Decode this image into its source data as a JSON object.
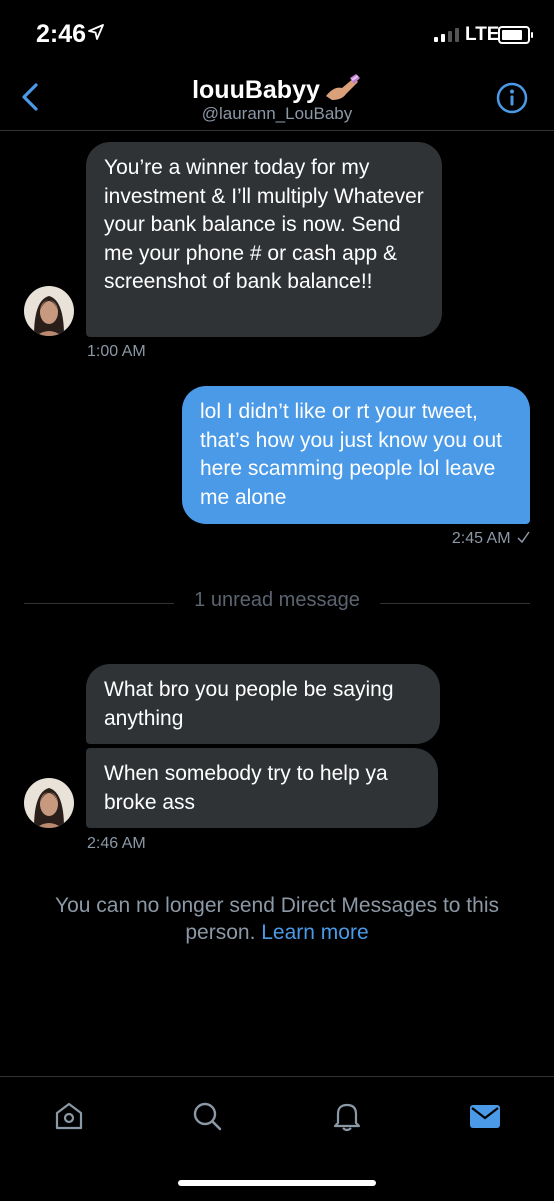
{
  "status_bar": {
    "time": "2:46",
    "network": "LTE"
  },
  "header": {
    "name": "louuBabyy",
    "handle": "@laurann_LouBaby"
  },
  "messages": {
    "m1": {
      "text": "You’re a winner today for my investment & I’ll multiply Whatever your bank balance is now. Send me your phone # or cash app & screenshot of bank balance!!",
      "time": "1:00 AM"
    },
    "m2": {
      "text": "lol I didn’t like or rt your tweet, that’s how you just know you out here scamming people lol leave me alone",
      "time": "2:45 AM"
    },
    "unread": "1 unread message",
    "m3": {
      "text": "What bro you people be saying anything"
    },
    "m4": {
      "text": "When somebody try to help ya broke ass",
      "time": "2:46 AM"
    }
  },
  "notice": {
    "text": "You can no longer send Direct Messages to this person.",
    "link": "Learn more"
  },
  "tabs": {
    "icons": [
      "home-icon",
      "search-icon",
      "notifications-icon",
      "messages-icon"
    ]
  },
  "colors": {
    "accent": "#4a9ae8",
    "incoming_bubble": "#2f3336",
    "background": "#000000"
  }
}
